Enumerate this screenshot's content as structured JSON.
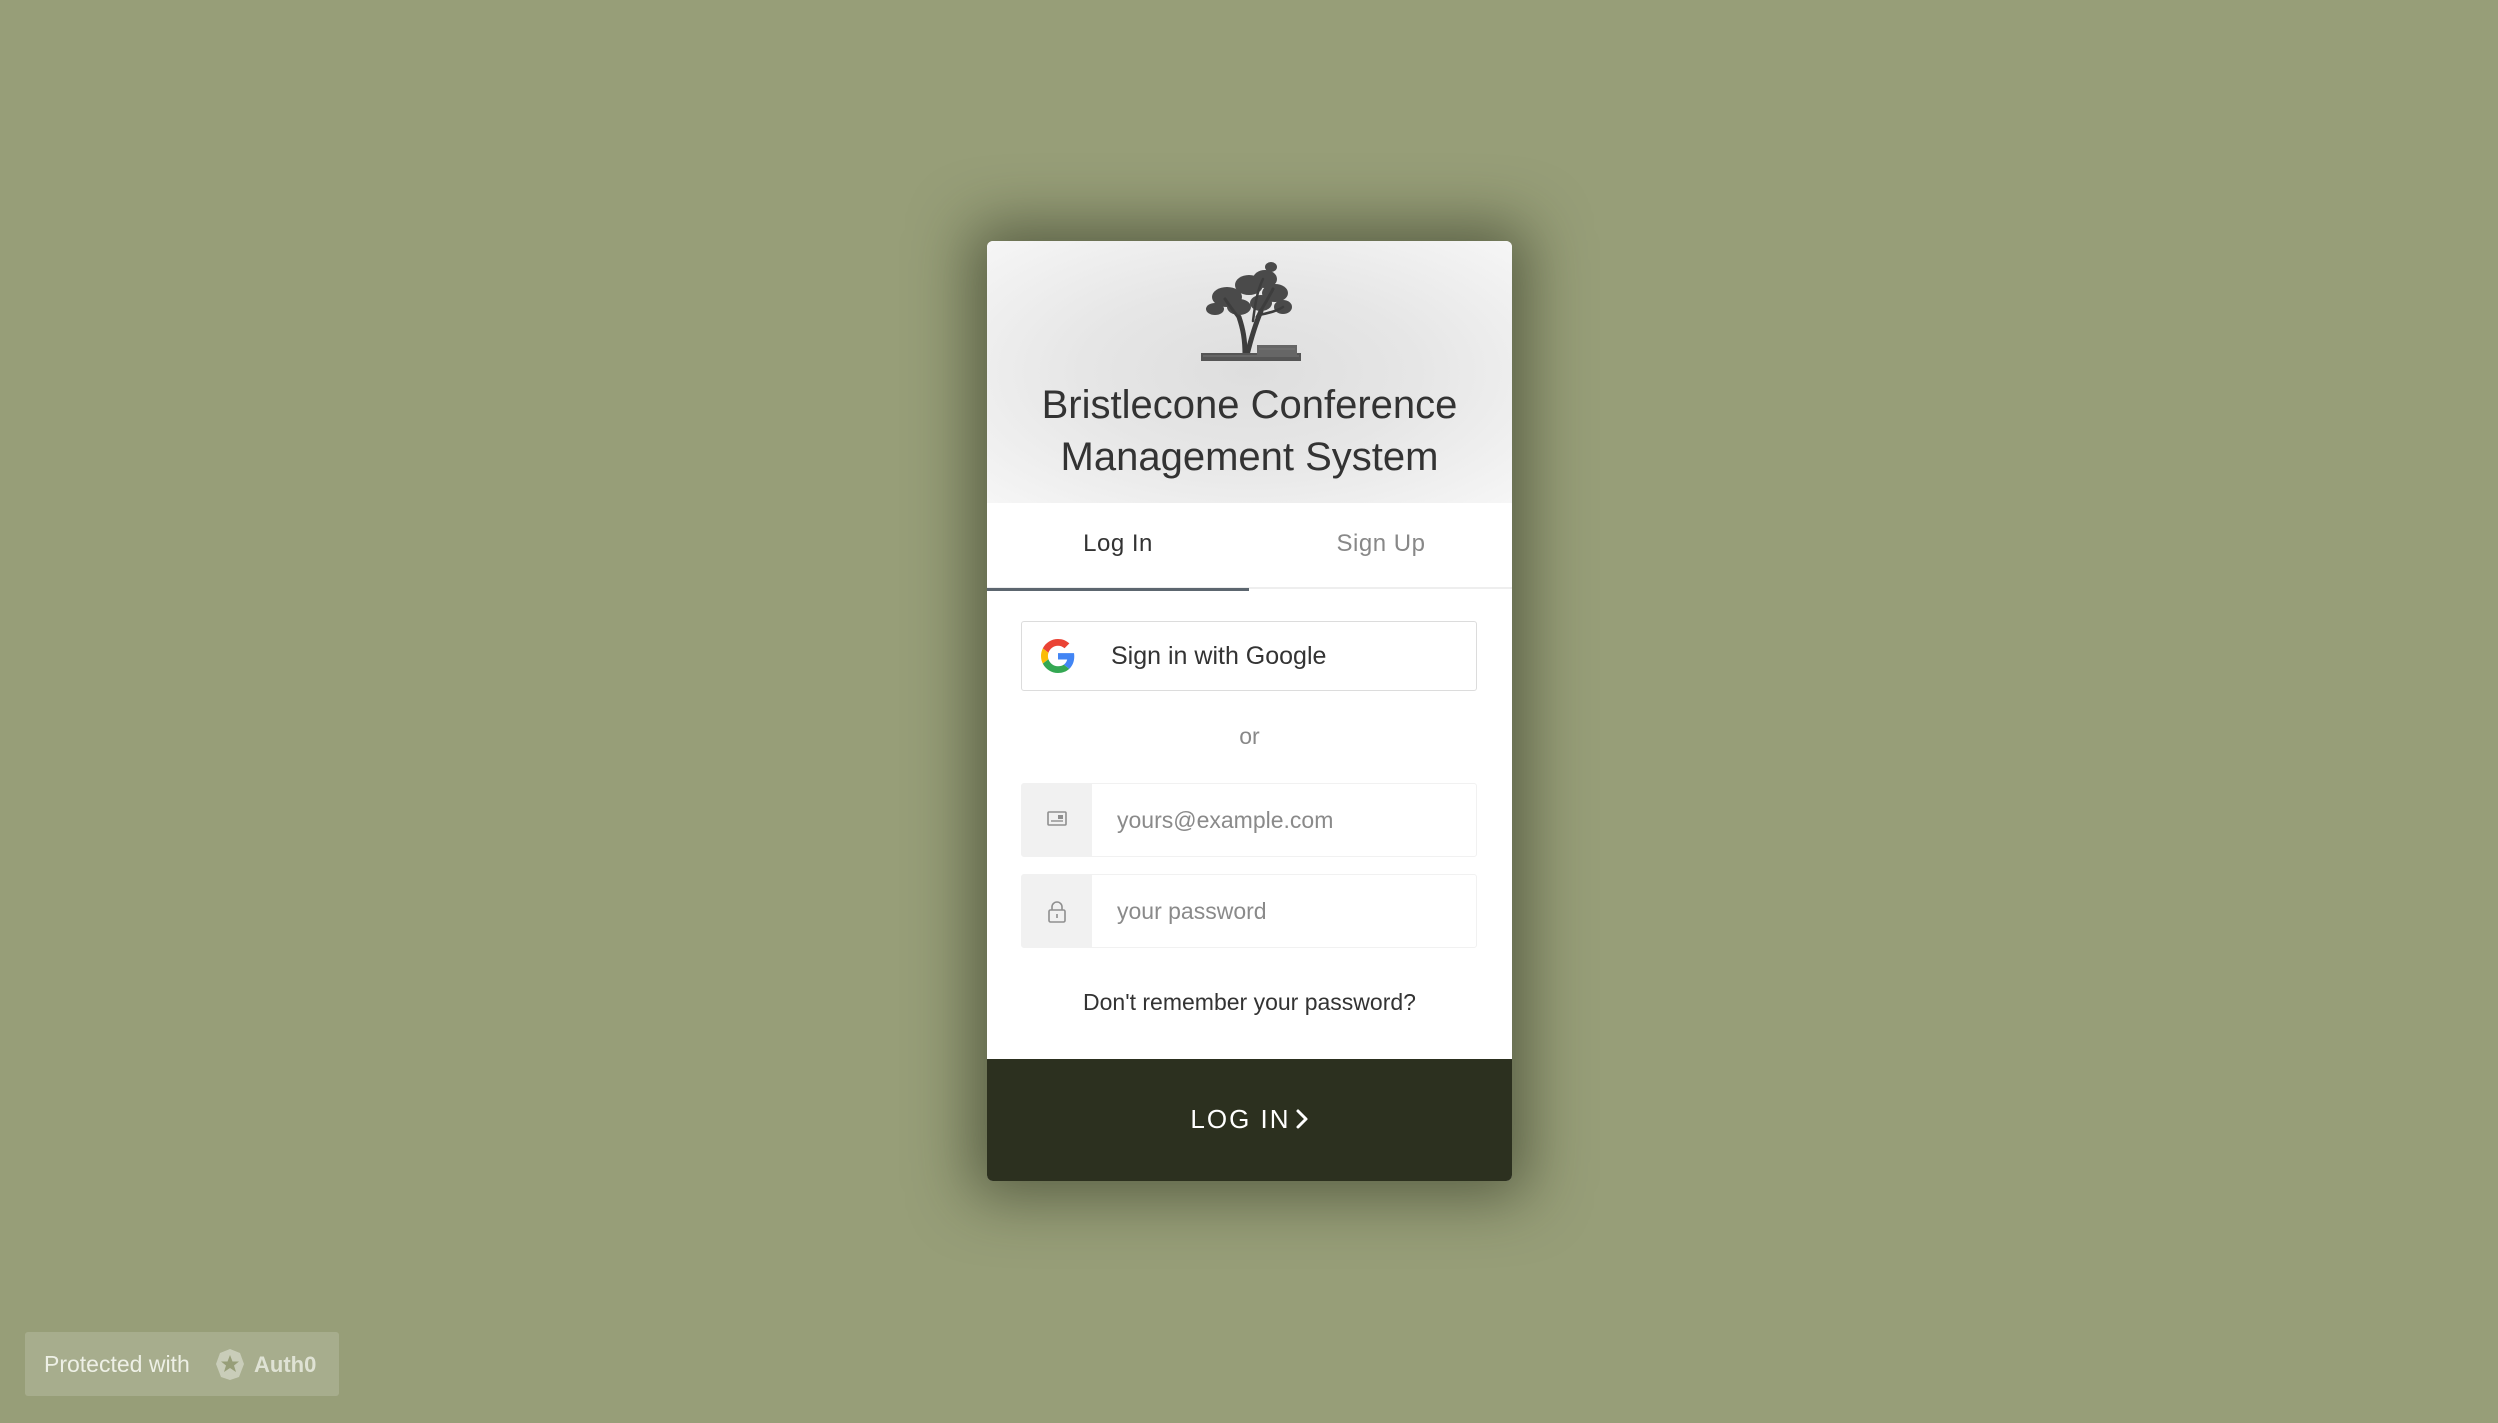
{
  "header": {
    "title": "Bristlecone Conference\nManagement System",
    "logo_icon": "bristlecone-tree-icon"
  },
  "tabs": [
    {
      "label": "Log In",
      "active": true
    },
    {
      "label": "Sign Up",
      "active": false
    }
  ],
  "social": {
    "google_label": "Sign in with Google",
    "google_icon": "google-g-icon"
  },
  "divider_text": "or",
  "form": {
    "email": {
      "placeholder": "yours@example.com",
      "value": "",
      "icon": "envelope-icon"
    },
    "password": {
      "placeholder": "your password",
      "value": "",
      "icon": "lock-icon"
    },
    "forgot_link": "Don't remember your password?",
    "submit_label": "LOG IN"
  },
  "footer_badge": {
    "text": "Protected with",
    "brand": "Auth0",
    "icon": "auth0-shield-icon"
  },
  "colors": {
    "page_background": "#979e78",
    "submit_background": "#2c301f",
    "active_tab_underline": "#5c666f"
  }
}
